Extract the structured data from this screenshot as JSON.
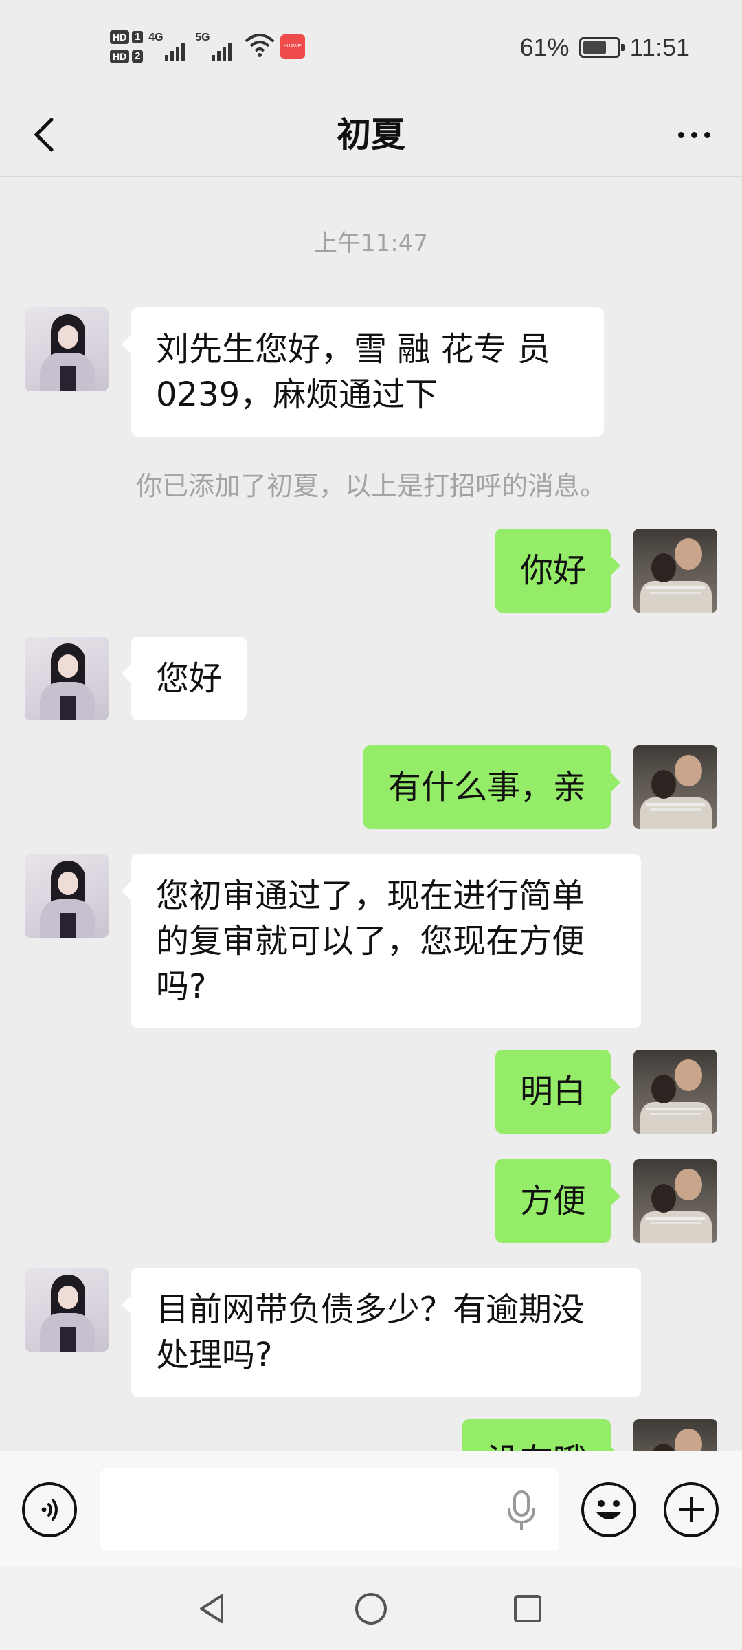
{
  "status_bar": {
    "sim1": "HD",
    "sim1_num": "1",
    "sim2": "HD",
    "sim2_num": "2",
    "net1": "4G",
    "net2": "5G",
    "app_badge": "HUAWEI",
    "battery_percent": "61%",
    "battery_level": 0.61,
    "time": "11:51"
  },
  "header": {
    "title": "初夏",
    "back_icon": "chevron-left-icon",
    "more_icon": "more-dots-icon"
  },
  "chat": {
    "timestamp": "上午11:47",
    "system_message": "你已添加了初夏，以上是打招呼的消息。",
    "messages": [
      {
        "side": "in",
        "text": "刘先生您好，雪 融 花专 员0239，麻烦通过下"
      },
      {
        "side": "out",
        "text": "你好"
      },
      {
        "side": "in",
        "text": "您好"
      },
      {
        "side": "out",
        "text": "有什么事，亲"
      },
      {
        "side": "in",
        "text": "您初审通过了，现在进行简单的复审就可以了，您现在方便吗?"
      },
      {
        "side": "out",
        "text": "明白"
      },
      {
        "side": "out",
        "text": "方便"
      },
      {
        "side": "in",
        "text": "目前网带负债多少？有逾期没处理吗?"
      },
      {
        "side": "out",
        "text": "没有哦"
      }
    ]
  },
  "input_bar": {
    "voice_icon": "voice-icon",
    "mic_icon": "microphone-icon",
    "emoji_icon": "emoji-icon",
    "plus_icon": "plus-icon",
    "text_value": ""
  },
  "nav_bar": {
    "back_icon": "triangle-back-icon",
    "home_icon": "circle-home-icon",
    "recent_icon": "square-recent-icon"
  },
  "colors": {
    "background": "#ededed",
    "outgoing_bubble": "#95ec69",
    "incoming_bubble": "#ffffff",
    "muted_text": "#a3a3a3"
  }
}
